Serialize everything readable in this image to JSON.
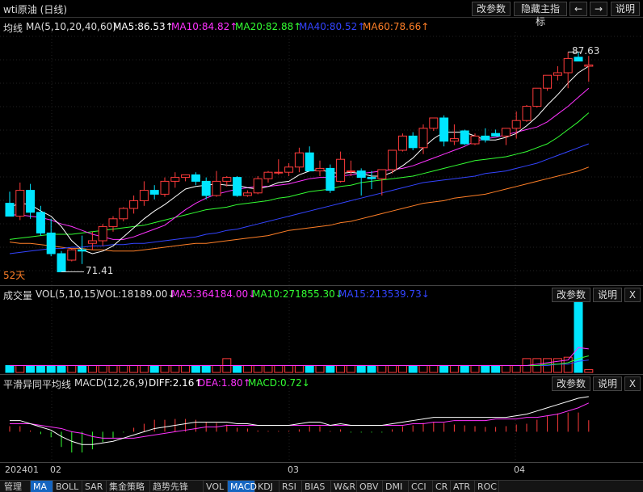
{
  "title": "wti原油 (日线)",
  "topButtons": {
    "params": "改参数",
    "hide": "隐藏主指标",
    "prev": "←",
    "next": "→",
    "help": "说明"
  },
  "mainLegend": {
    "label": "均线",
    "name": "MA(5,10,20,40,60)",
    "ma5": "MA5:86.53↑",
    "ma10": "MA10:84.82↑",
    "ma20": "MA20:82.88↑",
    "ma40": "MA40:80.52↑",
    "ma60": "MA60:78.66↑"
  },
  "periodLabel": "52天",
  "lowLabel": "71.41",
  "highLabel": "87.63",
  "volLegend": {
    "label": "成交量",
    "name": "VOL(5,10,15)",
    "vol": "VOL:18189.00↓",
    "ma5": "MA5:364184.00↓",
    "ma10": "MA10:271855.30↓",
    "ma15": "MA15:213539.73↓"
  },
  "macdLegend": {
    "label": "平滑异同平均线",
    "name": "MACD(12,26,9)",
    "diff": "DIFF:2.16↑",
    "dea": "DEA:1.80↑",
    "macd": "MACD:0.72↓"
  },
  "paneButtons": {
    "params": "改参数",
    "help": "说明",
    "close": "X"
  },
  "xLabels": [
    "202401",
    "02",
    "03",
    "04"
  ],
  "tabs": [
    "管理",
    "MA",
    "BOLL",
    "SAR",
    "集金策略",
    "趋势先锋",
    "VOL",
    "MACD",
    "KDJ",
    "RSI",
    "BIAS",
    "W&R",
    "OBV",
    "DMI",
    "CCI",
    "CR",
    "ATR",
    "ROC"
  ],
  "activeTabs": [
    "MA",
    "MACD"
  ],
  "colors": {
    "up": "#ff3b3b",
    "down": "#00e5ff",
    "ma5": "#ffffff",
    "ma10": "#ff33ff",
    "ma20": "#33ff33",
    "ma40": "#3344ff",
    "ma60": "#ff7f27"
  },
  "chart_data": [
    {
      "type": "candlestick",
      "title": "wti原油 (日线)",
      "ylim": [
        70,
        89
      ],
      "candles": [
        [
          75.9,
          76.8,
          74.9,
          74.9
        ],
        [
          74.9,
          77.5,
          74.6,
          76.9
        ],
        [
          76.9,
          77.4,
          74.7,
          75.2
        ],
        [
          75.2,
          75.7,
          73.4,
          73.6
        ],
        [
          73.6,
          74.7,
          71.8,
          72.0
        ],
        [
          72.0,
          72.2,
          70.6,
          70.6
        ],
        [
          71.5,
          72.4,
          71.4,
          72.3
        ],
        [
          72.3,
          73.4,
          71.2,
          72.2
        ],
        [
          72.8,
          73.7,
          72.3,
          73.0
        ],
        [
          73.0,
          74.3,
          72.6,
          74.1
        ],
        [
          74.1,
          74.9,
          73.7,
          74.7
        ],
        [
          74.7,
          75.6,
          74.5,
          75.5
        ],
        [
          75.5,
          76.5,
          75.1,
          76.1
        ],
        [
          76.1,
          77.6,
          75.7,
          76.9
        ],
        [
          76.9,
          77.3,
          76.2,
          76.6
        ],
        [
          76.6,
          77.9,
          76.4,
          77.6
        ],
        [
          77.6,
          78.3,
          77.1,
          77.9
        ],
        [
          77.9,
          78.1,
          77.6,
          78.1
        ],
        [
          78.1,
          78.3,
          77.3,
          77.6
        ],
        [
          77.6,
          77.9,
          76.2,
          76.5
        ],
        [
          76.5,
          78.4,
          76.4,
          77.6
        ],
        [
          77.6,
          78.0,
          77.2,
          77.9
        ],
        [
          77.9,
          78.0,
          76.4,
          76.5
        ],
        [
          76.5,
          76.9,
          76.4,
          76.7
        ],
        [
          76.7,
          78.0,
          76.6,
          77.8
        ],
        [
          77.8,
          78.4,
          77.5,
          78.3
        ],
        [
          78.3,
          79.3,
          78.1,
          78.3
        ],
        [
          78.3,
          79.0,
          78.0,
          78.7
        ],
        [
          78.7,
          80.2,
          78.3,
          79.8
        ],
        [
          79.8,
          80.3,
          78.7,
          78.4
        ],
        [
          78.4,
          79.2,
          78.0,
          78.6
        ],
        [
          78.6,
          78.9,
          76.7,
          76.9
        ],
        [
          77.6,
          79.9,
          77.5,
          79.3
        ],
        [
          78.4,
          79.2,
          78.0,
          78.4
        ],
        [
          78.4,
          78.6,
          76.5,
          77.9
        ],
        [
          77.9,
          78.4,
          77.0,
          77.8
        ],
        [
          77.8,
          78.5,
          76.5,
          78.5
        ],
        [
          78.5,
          80.0,
          78.2,
          80.0
        ],
        [
          80.0,
          81.3,
          79.9,
          81.1
        ],
        [
          81.1,
          81.4,
          80.0,
          80.2
        ],
        [
          80.2,
          82.0,
          79.7,
          81.7
        ],
        [
          81.7,
          82.5,
          81.5,
          82.5
        ],
        [
          82.5,
          82.7,
          80.3,
          80.7
        ],
        [
          80.7,
          82.0,
          80.4,
          80.9
        ],
        [
          81.5,
          81.6,
          80.4,
          80.5
        ],
        [
          80.5,
          81.3,
          80.4,
          81.1
        ],
        [
          81.1,
          81.7,
          80.6,
          80.8
        ],
        [
          81.3,
          81.6,
          81.1,
          81.1
        ],
        [
          81.1,
          81.7,
          80.4,
          81.7
        ],
        [
          81.7,
          83.0,
          80.9,
          82.3
        ],
        [
          82.3,
          83.5,
          82.2,
          83.4
        ],
        [
          83.4,
          84.5,
          83.3,
          84.8
        ],
        [
          84.8,
          85.8,
          84.6,
          85.8
        ],
        [
          85.8,
          86.5,
          85.4,
          86.0
        ],
        [
          86.0,
          87.6,
          84.8,
          87.1
        ],
        [
          87.2,
          87.6,
          86.9,
          86.9
        ],
        [
          86.5,
          87.3,
          85.3,
          86.6
        ]
      ],
      "ma": {
        "ma5": [
          75.6,
          75.9,
          75.8,
          75.3,
          74.9,
          74.1,
          73.0,
          72.3,
          72.0,
          72.2,
          72.6,
          73.3,
          74.0,
          74.7,
          75.3,
          75.8,
          76.4,
          77.0,
          77.2,
          77.3,
          77.4,
          77.3,
          77.3,
          77.1,
          77.0,
          77.2,
          77.5,
          77.6,
          78.1,
          78.4,
          78.5,
          78.3,
          78.2,
          78.3,
          78.2,
          78.0,
          78.0,
          78.3,
          78.8,
          79.4,
          80.2,
          80.9,
          81.4,
          81.4,
          81.4,
          81.1,
          80.8,
          80.8,
          81.0,
          81.3,
          81.9,
          82.6,
          83.5,
          84.3,
          85.2,
          86.0,
          86.5
        ],
        "ma10": [
          75.0,
          75.0,
          74.9,
          74.8,
          74.6,
          74.3,
          74.1,
          73.8,
          73.5,
          73.3,
          73.1,
          73.1,
          73.3,
          73.6,
          73.9,
          74.2,
          74.8,
          75.4,
          75.9,
          76.3,
          76.6,
          76.8,
          77.0,
          77.1,
          77.2,
          77.2,
          77.3,
          77.4,
          77.6,
          77.8,
          77.9,
          77.9,
          78.0,
          78.1,
          78.2,
          78.3,
          78.4,
          78.5,
          78.6,
          78.8,
          79.1,
          79.4,
          79.7,
          80.0,
          80.3,
          80.7,
          80.9,
          81.0,
          81.2,
          81.4,
          81.6,
          81.8,
          82.2,
          82.8,
          83.4,
          84.1,
          84.8
        ],
        "ma20": [
          73.1,
          73.2,
          73.3,
          73.4,
          73.5,
          73.5,
          73.5,
          73.6,
          73.7,
          73.8,
          73.9,
          74.0,
          74.1,
          74.2,
          74.4,
          74.6,
          74.8,
          75.0,
          75.2,
          75.4,
          75.5,
          75.6,
          75.8,
          75.9,
          76.0,
          76.1,
          76.3,
          76.4,
          76.6,
          76.8,
          76.9,
          77.0,
          77.2,
          77.3,
          77.5,
          77.6,
          77.7,
          77.8,
          77.9,
          78.0,
          78.2,
          78.4,
          78.6,
          78.8,
          79.0,
          79.2,
          79.3,
          79.4,
          79.5,
          79.7,
          79.9,
          80.2,
          80.5,
          81.0,
          81.6,
          82.2,
          82.9
        ],
        "ma40": [
          72.0,
          72.1,
          72.2,
          72.3,
          72.4,
          72.4,
          72.5,
          72.5,
          72.6,
          72.6,
          72.7,
          72.7,
          72.8,
          72.8,
          72.9,
          73.0,
          73.1,
          73.2,
          73.3,
          73.5,
          73.6,
          73.8,
          73.9,
          74.1,
          74.3,
          74.5,
          74.7,
          74.9,
          75.1,
          75.3,
          75.5,
          75.7,
          75.9,
          76.1,
          76.3,
          76.5,
          76.7,
          76.9,
          77.1,
          77.3,
          77.5,
          77.6,
          77.7,
          77.8,
          77.9,
          78.0,
          78.2,
          78.3,
          78.4,
          78.6,
          78.8,
          79.0,
          79.3,
          79.6,
          79.9,
          80.2,
          80.5
        ],
        "ma60": [
          72.9,
          72.8,
          72.8,
          72.7,
          72.6,
          72.5,
          72.4,
          72.4,
          72.3,
          72.3,
          72.2,
          72.2,
          72.2,
          72.3,
          72.4,
          72.5,
          72.6,
          72.7,
          72.8,
          72.8,
          72.9,
          73.0,
          73.1,
          73.2,
          73.3,
          73.4,
          73.6,
          73.8,
          73.9,
          74.0,
          74.1,
          74.2,
          74.4,
          74.5,
          74.7,
          74.9,
          75.1,
          75.3,
          75.5,
          75.7,
          75.9,
          76.0,
          76.1,
          76.3,
          76.4,
          76.5,
          76.6,
          76.8,
          77.0,
          77.2,
          77.4,
          77.6,
          77.8,
          78.0,
          78.2,
          78.4,
          78.7
        ]
      }
    },
    {
      "type": "bar",
      "title": "VOL(5,10,15)",
      "values": [
        5,
        5,
        5,
        5,
        5,
        5,
        5,
        5,
        5,
        5,
        5,
        5,
        5,
        5,
        5,
        5,
        5,
        5,
        5,
        5,
        5,
        10,
        5,
        5,
        5,
        5,
        5,
        5,
        5,
        5,
        5,
        5,
        5,
        5,
        5,
        5,
        5,
        5,
        5,
        5,
        5,
        5,
        5,
        5,
        5,
        5,
        5,
        5,
        5,
        5,
        10,
        10,
        10,
        10,
        11,
        51,
        2
      ],
      "ma": {
        "ma5": [
          5,
          5,
          5,
          5,
          5,
          5,
          5,
          5,
          5,
          5,
          5,
          5,
          5,
          5,
          5,
          5,
          5,
          5,
          5,
          5,
          5,
          5,
          5,
          5,
          5,
          5,
          5,
          5,
          5,
          5,
          5,
          5,
          5,
          5,
          5,
          5,
          5,
          5,
          5,
          5,
          5,
          5,
          5,
          5,
          5,
          5,
          5,
          5,
          5,
          5,
          5,
          6,
          7,
          8,
          9,
          18,
          17
        ],
        "ma10": [
          5,
          5,
          5,
          5,
          5,
          5,
          5,
          5,
          5,
          5,
          5,
          5,
          5,
          5,
          5,
          5,
          5,
          5,
          5,
          5,
          5,
          5,
          5,
          5,
          5,
          5,
          5,
          5,
          5,
          5,
          5,
          5,
          5,
          5,
          5,
          5,
          5,
          5,
          5,
          5,
          5,
          5,
          5,
          5,
          5,
          5,
          5,
          5,
          5,
          5,
          5,
          5,
          6,
          6,
          7,
          10,
          12
        ],
        "ma15": [
          5,
          5,
          5,
          5,
          5,
          5,
          5,
          5,
          5,
          5,
          5,
          5,
          5,
          5,
          5,
          5,
          5,
          5,
          5,
          5,
          5,
          5,
          5,
          5,
          5,
          5,
          5,
          5,
          5,
          5,
          5,
          5,
          5,
          5,
          5,
          5,
          5,
          5,
          5,
          5,
          5,
          5,
          5,
          5,
          5,
          5,
          5,
          5,
          5,
          5,
          5,
          5,
          5,
          6,
          6,
          8,
          9
        ]
      }
    },
    {
      "type": "line",
      "title": "MACD(12,26,9)",
      "diff": [
        0.7,
        0.7,
        0.5,
        0.3,
        0.1,
        -0.3,
        -0.6,
        -0.8,
        -0.8,
        -0.7,
        -0.6,
        -0.4,
        -0.2,
        0,
        0.2,
        0.3,
        0.4,
        0.5,
        0.6,
        0.6,
        0.6,
        0.6,
        0.5,
        0.5,
        0.4,
        0.4,
        0.4,
        0.4,
        0.5,
        0.6,
        0.6,
        0.4,
        0.5,
        0.4,
        0.4,
        0.4,
        0.4,
        0.5,
        0.6,
        0.7,
        0.8,
        0.9,
        0.9,
        0.9,
        0.9,
        0.9,
        0.9,
        0.9,
        0.9,
        1.0,
        1.1,
        1.3,
        1.5,
        1.7,
        1.9,
        2.1,
        2.2
      ],
      "dea": [
        0.5,
        0.5,
        0.5,
        0.4,
        0.3,
        0.2,
        0,
        -0.1,
        -0.3,
        -0.4,
        -0.4,
        -0.4,
        -0.4,
        -0.3,
        -0.2,
        -0.1,
        0,
        0.1,
        0.2,
        0.3,
        0.3,
        0.4,
        0.4,
        0.4,
        0.4,
        0.4,
        0.4,
        0.4,
        0.4,
        0.4,
        0.4,
        0.4,
        0.4,
        0.4,
        0.4,
        0.4,
        0.4,
        0.4,
        0.4,
        0.5,
        0.5,
        0.6,
        0.6,
        0.7,
        0.7,
        0.7,
        0.7,
        0.8,
        0.8,
        0.8,
        0.9,
        0.9,
        1.0,
        1.1,
        1.3,
        1.5,
        1.8
      ],
      "hist": [
        0.35,
        0.35,
        0.08,
        -0.15,
        -0.35,
        -0.95,
        -1.3,
        -1.3,
        -1.1,
        -0.65,
        -0.4,
        -0.05,
        0.25,
        0.5,
        0.75,
        0.75,
        0.8,
        0.8,
        0.75,
        0.6,
        0.55,
        0.45,
        0.25,
        0.2,
        0.08,
        0.05,
        0.05,
        0.05,
        0.15,
        0.35,
        0.35,
        0.05,
        0.15,
        -0.05,
        -0.05,
        -0.05,
        -0.05,
        0.15,
        0.35,
        0.4,
        0.55,
        0.6,
        0.55,
        0.45,
        0.4,
        0.35,
        0.3,
        0.3,
        0.35,
        0.45,
        0.5,
        0.75,
        1.0,
        1.15,
        1.2,
        1.2,
        0.72
      ],
      "ylim": [
        -1.8,
        2.6
      ]
    }
  ]
}
